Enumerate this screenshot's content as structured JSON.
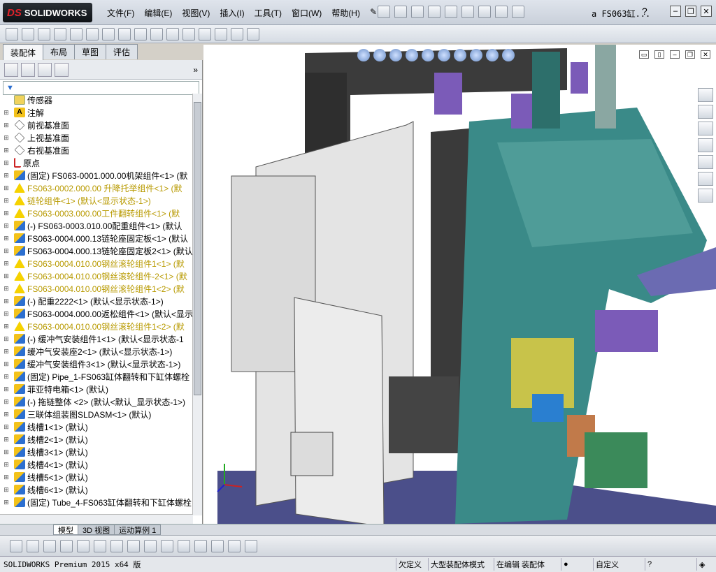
{
  "app": {
    "logo": "SOLIDWORKS",
    "logo_prefix": "DS",
    "doc_title": "a  FS063缸...",
    "help": "?"
  },
  "menu": [
    "文件(F)",
    "编辑(E)",
    "视图(V)",
    "插入(I)",
    "工具(T)",
    "窗口(W)",
    "帮助(H)"
  ],
  "tabs": [
    "装配体",
    "布局",
    "草图",
    "评估"
  ],
  "filter_icon": "filter-icon",
  "tree": [
    {
      "label": "传感器",
      "icon": "sensor",
      "style": "normal"
    },
    {
      "label": "注解",
      "icon": "annot",
      "style": "normal"
    },
    {
      "label": "前视基准面",
      "icon": "plane",
      "style": "normal"
    },
    {
      "label": "上视基准面",
      "icon": "plane",
      "style": "normal"
    },
    {
      "label": "右视基准面",
      "icon": "plane",
      "style": "normal"
    },
    {
      "label": "原点",
      "icon": "origin",
      "style": "normal"
    },
    {
      "label": "(固定) FS063-0001.000.00机架组件<1> (默",
      "icon": "asm",
      "style": "normal"
    },
    {
      "label": "FS063-0002.000.00 升降托举组件<1> (默",
      "icon": "warn",
      "style": "yellow"
    },
    {
      "label": "链轮组件<1> (默认<显示状态-1>)",
      "icon": "warn",
      "style": "yellow"
    },
    {
      "label": "FS063-0003.000.00工件翻转组件<1> (默",
      "icon": "warn",
      "style": "yellow"
    },
    {
      "label": "(-) FS063-0003.010.00配重组件<1> (默认",
      "icon": "asm",
      "style": "normal"
    },
    {
      "label": "FS063-0004.000.13链轮座固定板<1> (默认",
      "icon": "asm",
      "style": "normal"
    },
    {
      "label": "FS063-0004.000.13链轮座固定板2<1> (默认",
      "icon": "asm",
      "style": "normal"
    },
    {
      "label": "FS063-0004.010.00钢丝滚轮组件1<1> (默",
      "icon": "warn",
      "style": "yellow"
    },
    {
      "label": "FS063-0004.010.00钢丝滚轮组件-2<1> (默",
      "icon": "warn",
      "style": "yellow"
    },
    {
      "label": "FS063-0004.010.00钢丝滚轮组件1<2> (默",
      "icon": "warn",
      "style": "yellow"
    },
    {
      "label": "(-) 配重2222<1> (默认<显示状态-1>)",
      "icon": "asm",
      "style": "normal"
    },
    {
      "label": "FS063-0004.000.00返松组件<1> (默认<显示",
      "icon": "asm",
      "style": "normal"
    },
    {
      "label": "FS063-0004.010.00钢丝滚轮组件1<2> (默",
      "icon": "warn",
      "style": "yellow"
    },
    {
      "label": "(-) 缓冲气安装组件1<1> (默认<显示状态-1",
      "icon": "asm",
      "style": "normal"
    },
    {
      "label": "缓冲气安装座2<1> (默认<显示状态-1>)",
      "icon": "asm",
      "style": "normal"
    },
    {
      "label": "缓冲气安装组件3<1> (默认<显示状态-1>)",
      "icon": "asm",
      "style": "normal"
    },
    {
      "label": "(固定) Pipe_1-FS063缸体翻转和下缸体螺栓",
      "icon": "asm",
      "style": "normal"
    },
    {
      "label": "菲亚特电箱<1> (默认)",
      "icon": "asm",
      "style": "normal"
    },
    {
      "label": "(-) 拖链整体 <2> (默认<默认_显示状态-1>)",
      "icon": "asm",
      "style": "normal"
    },
    {
      "label": "三联体组装图SLDASM<1> (默认)",
      "icon": "asm",
      "style": "normal"
    },
    {
      "label": "线槽1<1> (默认)",
      "icon": "asm",
      "style": "normal"
    },
    {
      "label": "线槽2<1> (默认)",
      "icon": "asm",
      "style": "normal"
    },
    {
      "label": "线槽3<1> (默认)",
      "icon": "asm",
      "style": "normal"
    },
    {
      "label": "线槽4<1> (默认)",
      "icon": "asm",
      "style": "normal"
    },
    {
      "label": "线槽5<1> (默认)",
      "icon": "asm",
      "style": "normal"
    },
    {
      "label": "线槽6<1> (默认)",
      "icon": "asm",
      "style": "normal"
    },
    {
      "label": "(固定) Tube_4-FS063缸体翻转和下缸体螺栓",
      "icon": "asm",
      "style": "normal"
    }
  ],
  "bottom_tabs": [
    "模型",
    "3D 视图",
    "运动算例 1"
  ],
  "status": {
    "product": "SOLIDWORKS Premium 2015 x64 版",
    "underdefined": "欠定义",
    "mode": "大型装配体模式",
    "editing": "在编辑 装配体",
    "custom": "自定义"
  },
  "colors": {
    "accent": "#2c6fd0",
    "warn": "#b89a00",
    "frame_dark": "#3a3a3a",
    "machine_teal": "#3a8a88",
    "machine_purple": "#7b5bb8"
  }
}
